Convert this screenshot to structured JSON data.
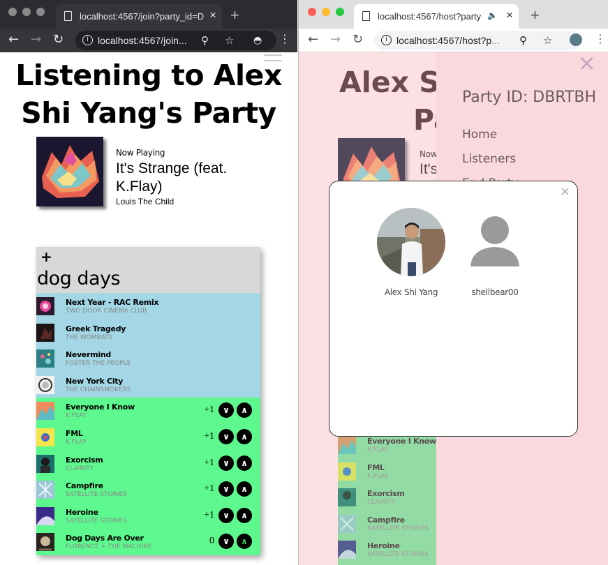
{
  "left_window": {
    "tab_title": "localhost:4567/join?party_id=D",
    "url": "localhost:4567/join...",
    "party_title": "Listening to Alex Shi Yang's Party",
    "now_playing": {
      "label": "Now Playing",
      "title": "It's Strange (feat. K.Flay)",
      "artist": "Louis The Child"
    },
    "playlist": {
      "add_label": "+",
      "name": "dog days",
      "songs": [
        {
          "title": "Next Year - RAC Remix",
          "artist": "TWO DOOR CINEMA CLUB",
          "state": "played"
        },
        {
          "title": "Greek Tragedy",
          "artist": "THE WOMBATS",
          "state": "played"
        },
        {
          "title": "Nevermind",
          "artist": "FOSTER THE PEOPLE",
          "state": "played"
        },
        {
          "title": "New York City",
          "artist": "THE CHAINSMOKERS",
          "state": "played"
        },
        {
          "title": "Everyone I Know",
          "artist": "K.FLAY",
          "state": "queued",
          "votes": "+1"
        },
        {
          "title": "FML",
          "artist": "K.FLAY",
          "state": "queued",
          "votes": "+1"
        },
        {
          "title": "Exorcism",
          "artist": "CLAIRITY",
          "state": "queued",
          "votes": "+1"
        },
        {
          "title": "Campfire",
          "artist": "SATELLITE STORIES",
          "state": "queued",
          "votes": "+1"
        },
        {
          "title": "Heroine",
          "artist": "SATELLITE STORIES",
          "state": "queued",
          "votes": "+1"
        },
        {
          "title": "Dog Days Are Over",
          "artist": "FLORENCE + THE MACHINE",
          "state": "queued",
          "votes": "0"
        }
      ]
    }
  },
  "right_window": {
    "tab_title": "localhost:4567/host?party",
    "url_prefix": "localhost:4567/host?p",
    "url_dim": "...",
    "party_title_line1": "Alex Sh",
    "party_title_line2": "Pa",
    "now_playing": {
      "label": "Now",
      "title": "It's"
    },
    "drawer": {
      "close_label": "×",
      "party_id": "Party ID: DBRTBH",
      "nav_items": [
        "Home",
        "Listeners",
        "End Party"
      ]
    },
    "listeners_modal": {
      "close_label": "×",
      "listeners": [
        {
          "name": "Alex Shi Yang",
          "avatar": "photo"
        },
        {
          "name": "shellbear00",
          "avatar": "placeholder"
        }
      ]
    },
    "visible_songs": [
      {
        "title": "Everyone I Know",
        "artist": "K.FLAY"
      },
      {
        "title": "FML",
        "artist": "K.FLAY"
      },
      {
        "title": "Exorcism",
        "artist": "CLAIRITY"
      },
      {
        "title": "Campfire",
        "artist": "SATELLITE STORIES"
      },
      {
        "title": "Heroine",
        "artist": "SATELLITE STORIES"
      }
    ]
  },
  "colors": {
    "played_row": "#a3d7e6",
    "queued_row": "#5ef98e",
    "drawer_bg": "#fad9de",
    "host_bg": "#fde0e4"
  }
}
